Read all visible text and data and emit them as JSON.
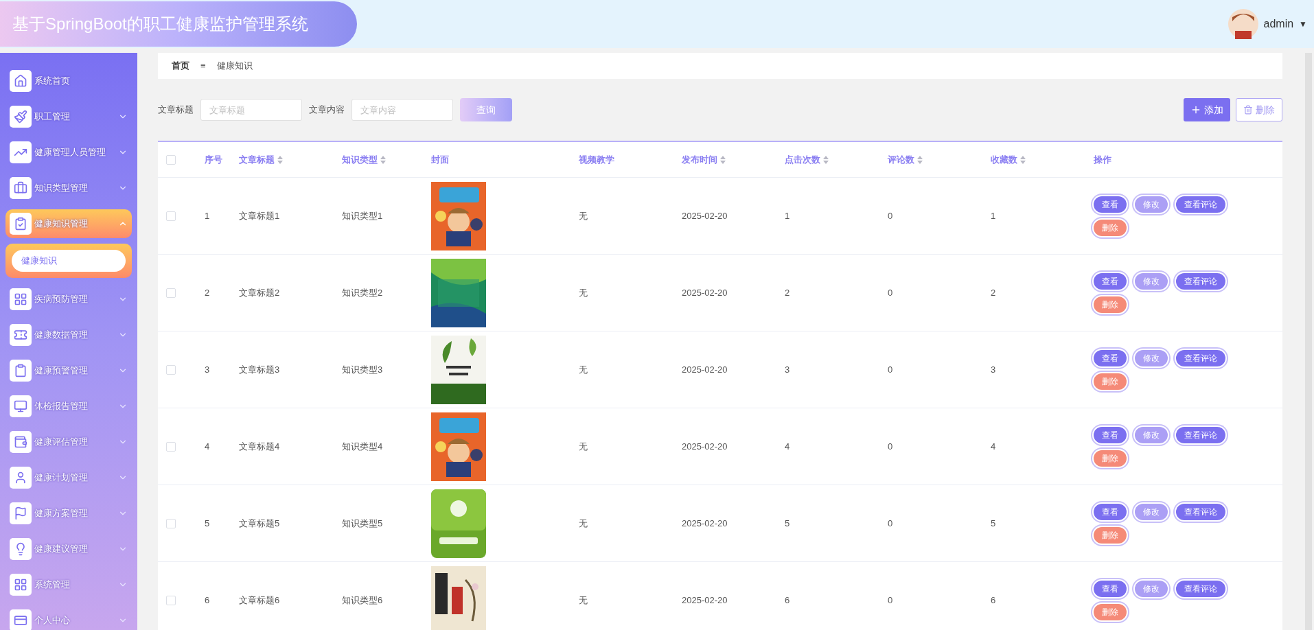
{
  "header": {
    "title": "基于SpringBoot的职工健康监护管理系统",
    "user": "admin",
    "user_caret": "▼"
  },
  "sidebar": {
    "items": [
      {
        "label": "系统首页",
        "kind": "link",
        "selected": false
      },
      {
        "label": "职工管理",
        "kind": "group",
        "expanded": false,
        "selected": false
      },
      {
        "label": "健康管理人员管理",
        "kind": "group",
        "expanded": false,
        "selected": false
      },
      {
        "label": "知识类型管理",
        "kind": "group",
        "expanded": false,
        "selected": false
      },
      {
        "label": "健康知识管理",
        "kind": "group",
        "expanded": true,
        "selected": true,
        "children": [
          {
            "label": "健康知识",
            "selected": true
          }
        ]
      },
      {
        "label": "疾病预防管理",
        "kind": "group",
        "expanded": false,
        "selected": false
      },
      {
        "label": "健康数据管理",
        "kind": "group",
        "expanded": false,
        "selected": false
      },
      {
        "label": "健康预警管理",
        "kind": "group",
        "expanded": false,
        "selected": false
      },
      {
        "label": "体检报告管理",
        "kind": "group",
        "expanded": false,
        "selected": false
      },
      {
        "label": "健康评估管理",
        "kind": "group",
        "expanded": false,
        "selected": false
      },
      {
        "label": "健康计划管理",
        "kind": "group",
        "expanded": false,
        "selected": false
      },
      {
        "label": "健康方案管理",
        "kind": "group",
        "expanded": false,
        "selected": false
      },
      {
        "label": "健康建议管理",
        "kind": "group",
        "expanded": false,
        "selected": false
      },
      {
        "label": "系统管理",
        "kind": "group",
        "expanded": false,
        "selected": false
      },
      {
        "label": "个人中心",
        "kind": "group",
        "expanded": false,
        "selected": false
      }
    ]
  },
  "breadcrumb": {
    "home": "首页",
    "separator": "≡",
    "current": "健康知识"
  },
  "search": {
    "fields": [
      {
        "label": "文章标题",
        "placeholder": "文章标题"
      },
      {
        "label": "文章内容",
        "placeholder": "文章内容"
      }
    ],
    "query_button": "查询",
    "add_button": "添加",
    "delete_button": "删除"
  },
  "table": {
    "select_all_checked": false,
    "columns": [
      {
        "label": "序号",
        "sortable": false
      },
      {
        "label": "文章标题",
        "sortable": true
      },
      {
        "label": "知识类型",
        "sortable": true
      },
      {
        "label": "封面",
        "sortable": false
      },
      {
        "label": "视频教学",
        "sortable": false
      },
      {
        "label": "发布时间",
        "sortable": true
      },
      {
        "label": "点击次数",
        "sortable": true
      },
      {
        "label": "评论数",
        "sortable": true
      },
      {
        "label": "收藏数",
        "sortable": true
      },
      {
        "label": "操作",
        "sortable": false
      }
    ],
    "rows": [
      {
        "checked": false,
        "index": "1",
        "title": "文章标题1",
        "type": "知识类型1",
        "video": "无",
        "date": "2025-02-20",
        "clicks": "1",
        "comments": "0",
        "favorites": "1",
        "actions": [
          {
            "label": "查看",
            "kind": "view"
          },
          {
            "label": "修改",
            "kind": "edit"
          },
          {
            "label": "查看评论",
            "kind": "comments"
          },
          {
            "label": "删除",
            "kind": "delete"
          }
        ]
      },
      {
        "checked": false,
        "index": "2",
        "title": "文章标题2",
        "type": "知识类型2",
        "video": "无",
        "date": "2025-02-20",
        "clicks": "2",
        "comments": "0",
        "favorites": "2",
        "actions": [
          {
            "label": "查看",
            "kind": "view"
          },
          {
            "label": "修改",
            "kind": "edit"
          },
          {
            "label": "查看评论",
            "kind": "comments"
          },
          {
            "label": "删除",
            "kind": "delete"
          }
        ]
      },
      {
        "checked": false,
        "index": "3",
        "title": "文章标题3",
        "type": "知识类型3",
        "video": "无",
        "date": "2025-02-20",
        "clicks": "3",
        "comments": "0",
        "favorites": "3",
        "actions": [
          {
            "label": "查看",
            "kind": "view"
          },
          {
            "label": "修改",
            "kind": "edit"
          },
          {
            "label": "查看评论",
            "kind": "comments"
          },
          {
            "label": "删除",
            "kind": "delete"
          }
        ]
      },
      {
        "checked": false,
        "index": "4",
        "title": "文章标题4",
        "type": "知识类型4",
        "video": "无",
        "date": "2025-02-20",
        "clicks": "4",
        "comments": "0",
        "favorites": "4",
        "actions": [
          {
            "label": "查看",
            "kind": "view"
          },
          {
            "label": "修改",
            "kind": "edit"
          },
          {
            "label": "查看评论",
            "kind": "comments"
          },
          {
            "label": "删除",
            "kind": "delete"
          }
        ]
      },
      {
        "checked": false,
        "index": "5",
        "title": "文章标题5",
        "type": "知识类型5",
        "video": "无",
        "date": "2025-02-20",
        "clicks": "5",
        "comments": "0",
        "favorites": "5",
        "actions": [
          {
            "label": "查看",
            "kind": "view"
          },
          {
            "label": "修改",
            "kind": "edit"
          },
          {
            "label": "查看评论",
            "kind": "comments"
          },
          {
            "label": "删除",
            "kind": "delete"
          }
        ]
      },
      {
        "checked": false,
        "index": "6",
        "title": "文章标题6",
        "type": "知识类型6",
        "video": "无",
        "date": "2025-02-20",
        "clicks": "6",
        "comments": "0",
        "favorites": "6",
        "actions": [
          {
            "label": "查看",
            "kind": "view"
          },
          {
            "label": "修改",
            "kind": "edit"
          },
          {
            "label": "查看评论",
            "kind": "comments"
          },
          {
            "label": "删除",
            "kind": "delete"
          }
        ]
      }
    ]
  }
}
